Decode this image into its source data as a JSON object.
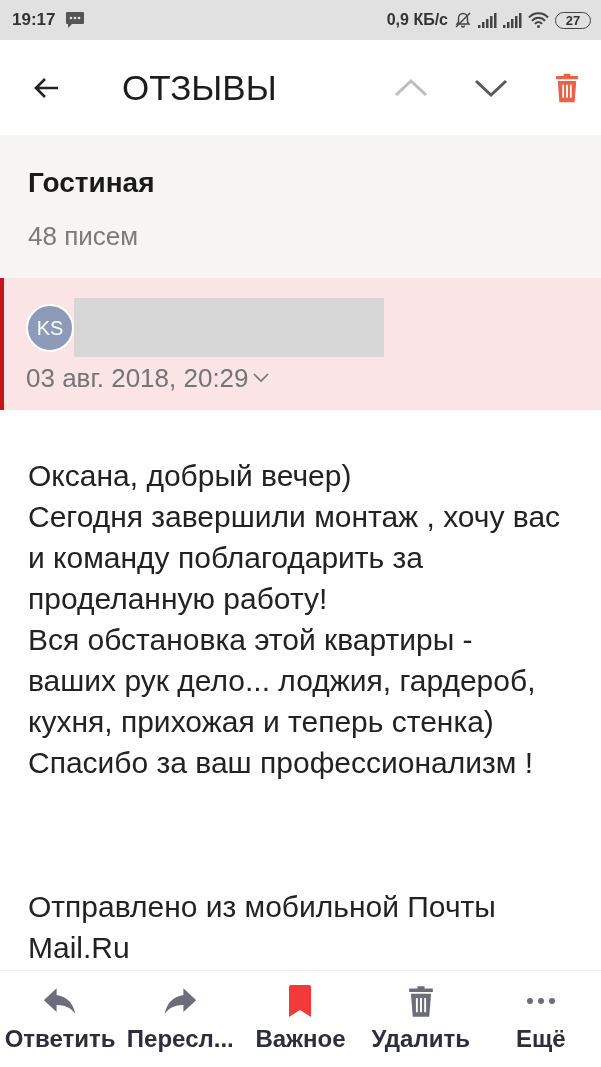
{
  "status_bar": {
    "time": "19:17",
    "network_speed": "0,9 КБ/с",
    "battery": "27"
  },
  "toolbar": {
    "title": "ОТЗЫВЫ",
    "nav": [
      {
        "kind": "previous",
        "disabled": true
      },
      {
        "kind": "next",
        "disabled": false
      }
    ]
  },
  "folder": {
    "name": "Гостиная",
    "count": "48 писем"
  },
  "message": {
    "avatar_initials": "KS",
    "date": "03 авг. 2018, 20:29",
    "body": [
      "Оксана, добрый вечер)",
      "Сегодня завершили монтаж , хочу вас и команду поблагодарить за проделанную работу!",
      "Вся обстановка этой квартиры - ваших рук дело... лоджия, гардероб, кухня, прихожая и теперь стенка)",
      "Спасибо за ваш профессионализм !"
    ],
    "signature": "Отправлено из мобильной Почты Mail.Ru"
  },
  "actions": [
    {
      "kind": "reply",
      "label": "Ответить",
      "active": false
    },
    {
      "kind": "forward",
      "label": "Пересл...",
      "active": false
    },
    {
      "kind": "important",
      "label": "Важное",
      "active": true
    },
    {
      "kind": "delete",
      "label": "Удалить",
      "active": false
    },
    {
      "kind": "more",
      "label": "Ещё",
      "active": false
    }
  ]
}
